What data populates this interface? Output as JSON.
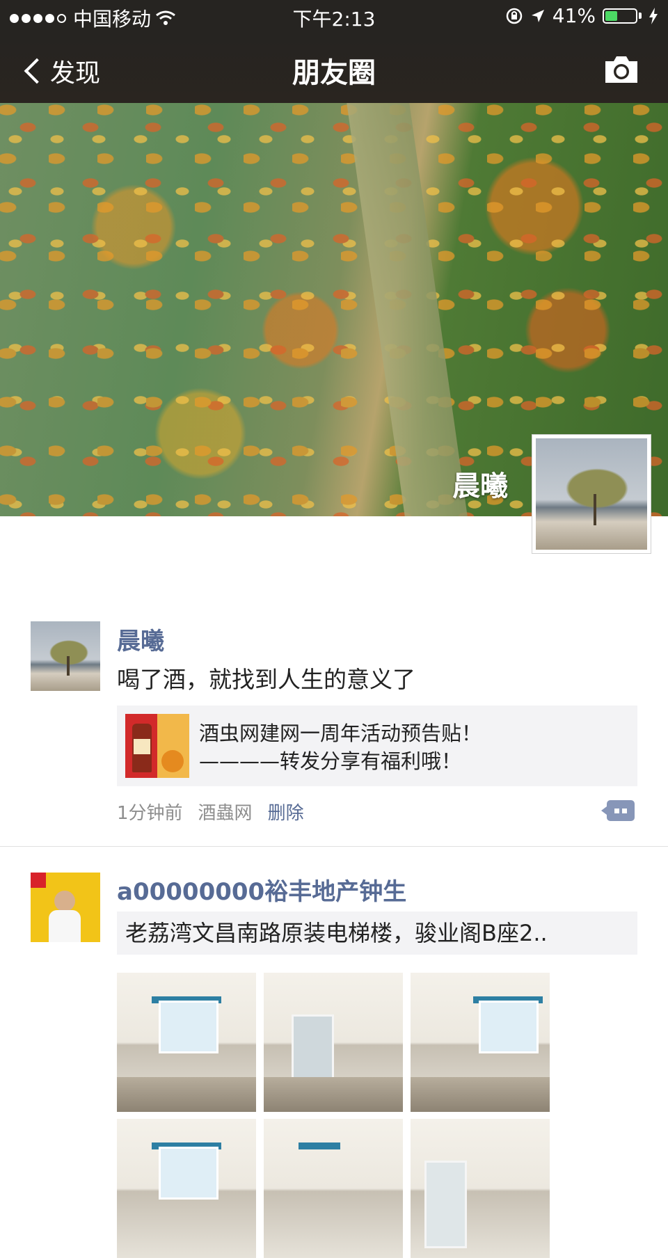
{
  "status_bar": {
    "carrier": "中国移动",
    "time": "下午2:13",
    "battery": "41%",
    "battery_level": 0.41
  },
  "nav": {
    "back_label": "发现",
    "title": "朋友圈",
    "camera_icon": "camera-icon"
  },
  "cover": {
    "user_name": "晨曦"
  },
  "posts": [
    {
      "name": "晨曦",
      "text": "喝了酒，就找到人生的意义了",
      "link": {
        "line1": "酒虫网建网一周年活动预告贴！",
        "line2": "————转发分享有福利哦！"
      },
      "time": "1分钟前",
      "source": "酒蟲网",
      "delete_label": "删除"
    },
    {
      "name": "a00000000裕丰地产钟生",
      "share_text": "老荔湾文昌南路原装电梯楼，骏业阁B座2.."
    }
  ],
  "colors": {
    "nav_bg": "#262421",
    "link_blue": "#576b95",
    "battery_green": "#4cd964"
  }
}
